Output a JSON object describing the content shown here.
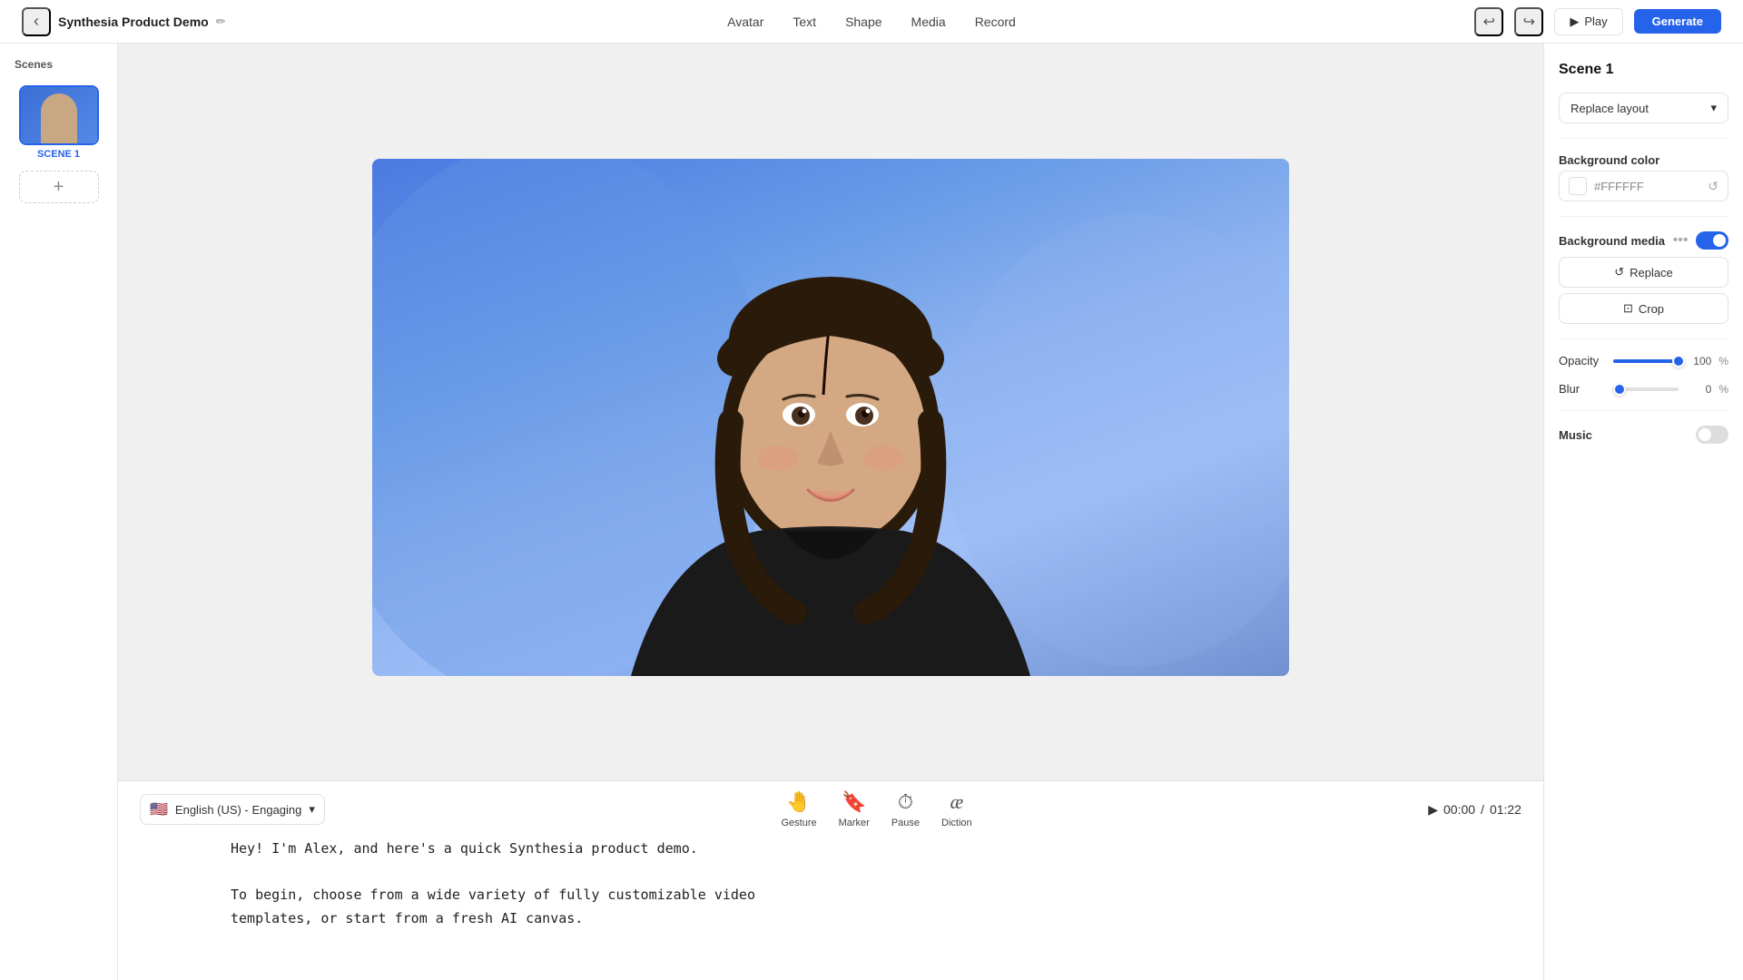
{
  "app": {
    "title": "Synthesia Product Demo",
    "edit_icon": "✏️"
  },
  "nav": {
    "back_label": "‹",
    "tabs": [
      "Avatar",
      "Text",
      "Shape",
      "Media",
      "Record"
    ],
    "play_label": "Play",
    "generate_label": "Generate"
  },
  "scenes": {
    "label": "Scenes",
    "items": [
      {
        "name": "SCENE 1",
        "active": true
      }
    ],
    "add_label": "+"
  },
  "right_panel": {
    "scene_title": "Scene 1",
    "layout_label": "Replace layout",
    "background_color_label": "Background color",
    "background_color_value": "#FFFFFF",
    "background_media_label": "Background media",
    "replace_label": "Replace",
    "crop_label": "Crop",
    "opacity_label": "Opacity",
    "opacity_value": "100",
    "opacity_unit": "%",
    "blur_label": "Blur",
    "blur_value": "0",
    "blur_unit": "%",
    "music_label": "Music"
  },
  "script": {
    "language": "English (US) - Engaging",
    "actions": [
      {
        "icon": "🤚",
        "label": "Gesture"
      },
      {
        "icon": "🔖",
        "label": "Marker"
      },
      {
        "icon": "⏱",
        "label": "Pause"
      },
      {
        "icon": "æ",
        "label": "Diction"
      }
    ],
    "timer_current": "00:00",
    "timer_total": "01:22",
    "lines": [
      "Hey! I'm Alex, and here's a quick Synthesia product demo.",
      "",
      "To begin, choose from a wide variety of fully customizable video",
      "templates, or start from a fresh AI canvas."
    ]
  }
}
